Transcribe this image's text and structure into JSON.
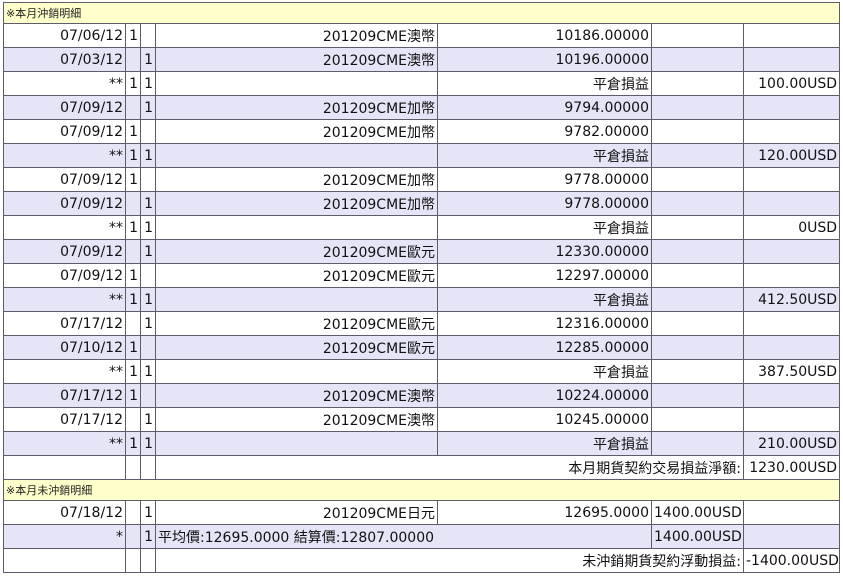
{
  "sections": {
    "closed_title": "※本月沖銷明細",
    "open_title": "※本月未沖銷明細"
  },
  "closed_rows": [
    {
      "date": "07/06/12",
      "a": "1",
      "b": "",
      "contract": "201209CME澳幣",
      "price": "10186.00000",
      "fee": "",
      "pl": ""
    },
    {
      "date": "07/03/12",
      "a": "",
      "b": "1",
      "contract": "201209CME澳幣",
      "price": "10196.00000",
      "fee": "",
      "pl": ""
    },
    {
      "date": "**",
      "a": "1",
      "b": "1",
      "contract": "",
      "price": "平倉損益",
      "fee": "",
      "pl": "100.00USD"
    },
    {
      "date": "07/09/12",
      "a": "",
      "b": "1",
      "contract": "201209CME加幣",
      "price": "9794.00000",
      "fee": "",
      "pl": ""
    },
    {
      "date": "07/09/12",
      "a": "1",
      "b": "",
      "contract": "201209CME加幣",
      "price": "9782.00000",
      "fee": "",
      "pl": ""
    },
    {
      "date": "**",
      "a": "1",
      "b": "1",
      "contract": "",
      "price": "平倉損益",
      "fee": "",
      "pl": "120.00USD"
    },
    {
      "date": "07/09/12",
      "a": "1",
      "b": "",
      "contract": "201209CME加幣",
      "price": "9778.00000",
      "fee": "",
      "pl": ""
    },
    {
      "date": "07/09/12",
      "a": "",
      "b": "1",
      "contract": "201209CME加幣",
      "price": "9778.00000",
      "fee": "",
      "pl": ""
    },
    {
      "date": "**",
      "a": "1",
      "b": "1",
      "contract": "",
      "price": "平倉損益",
      "fee": "",
      "pl": "0USD"
    },
    {
      "date": "07/09/12",
      "a": "",
      "b": "1",
      "contract": "201209CME歐元",
      "price": "12330.00000",
      "fee": "",
      "pl": ""
    },
    {
      "date": "07/09/12",
      "a": "1",
      "b": "",
      "contract": "201209CME歐元",
      "price": "12297.00000",
      "fee": "",
      "pl": ""
    },
    {
      "date": "**",
      "a": "1",
      "b": "1",
      "contract": "",
      "price": "平倉損益",
      "fee": "",
      "pl": "412.50USD"
    },
    {
      "date": "07/17/12",
      "a": "",
      "b": "1",
      "contract": "201209CME歐元",
      "price": "12316.00000",
      "fee": "",
      "pl": ""
    },
    {
      "date": "07/10/12",
      "a": "1",
      "b": "",
      "contract": "201209CME歐元",
      "price": "12285.00000",
      "fee": "",
      "pl": ""
    },
    {
      "date": "**",
      "a": "1",
      "b": "1",
      "contract": "",
      "price": "平倉損益",
      "fee": "",
      "pl": "387.50USD"
    },
    {
      "date": "07/17/12",
      "a": "1",
      "b": "",
      "contract": "201209CME澳幣",
      "price": "10224.00000",
      "fee": "",
      "pl": ""
    },
    {
      "date": "07/17/12",
      "a": "",
      "b": "1",
      "contract": "201209CME澳幣",
      "price": "10245.00000",
      "fee": "",
      "pl": ""
    },
    {
      "date": "**",
      "a": "1",
      "b": "1",
      "contract": "",
      "price": "平倉損益",
      "fee": "",
      "pl": "210.00USD"
    }
  ],
  "closed_total": {
    "label": "本月期貨契約交易損益淨額:",
    "value": "1230.00USD"
  },
  "open_rows": [
    {
      "date": "07/18/12",
      "a": "",
      "b": "1",
      "contract": "201209CME日元",
      "price": "12695.0000",
      "fee": "1400.00USD",
      "pl": ""
    }
  ],
  "open_avg": {
    "date": "*",
    "a": "",
    "b": "1",
    "text": "平均價:12695.0000 結算價:12807.00000",
    "fee": "1400.00USD",
    "pl": ""
  },
  "open_total": {
    "label": "未沖銷期貨契約浮動損益:",
    "value": "-1400.00USD"
  }
}
